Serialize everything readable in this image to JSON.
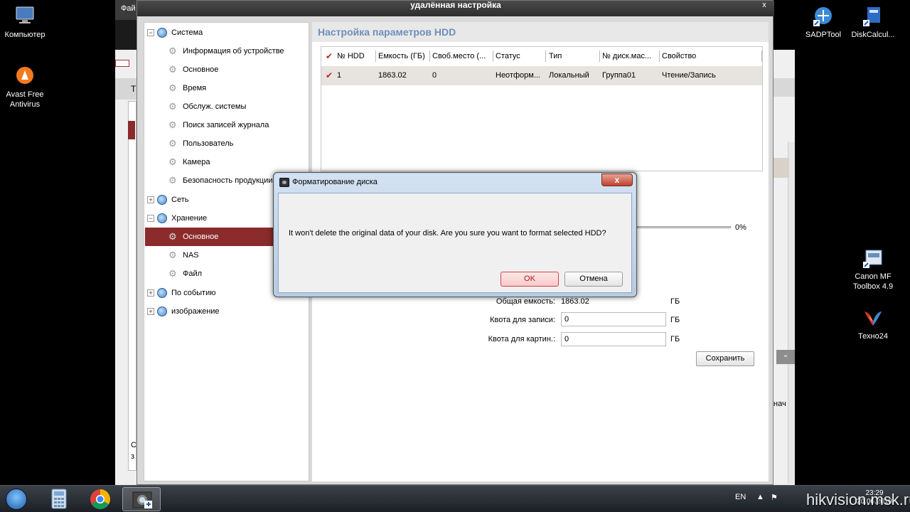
{
  "desktop": {
    "icons": [
      {
        "label": "Компьютер"
      },
      {
        "label": "Avast Free Antivirus"
      },
      {
        "label": "SADPTool"
      },
      {
        "label": "DiskCalcul..."
      },
      {
        "label": "Canon MF Toolbox 4.9"
      },
      {
        "label": "Техно24"
      }
    ]
  },
  "bg_app": {
    "title_fragment": "Фай",
    "tab_fragment": "Т",
    "low_text": "С з",
    "right_text": "нач"
  },
  "window": {
    "title": "удалённая настройка",
    "close_glyph": "x"
  },
  "sidebar": {
    "items": [
      {
        "label": "Система",
        "type": "group",
        "expanded": true
      },
      {
        "label": "Информация об устройстве",
        "type": "child"
      },
      {
        "label": "Основное",
        "type": "child"
      },
      {
        "label": "Время",
        "type": "child"
      },
      {
        "label": "Обслуж. системы",
        "type": "child"
      },
      {
        "label": "Поиск записей журнала",
        "type": "child"
      },
      {
        "label": "Пользователь",
        "type": "child"
      },
      {
        "label": "Камера",
        "type": "child"
      },
      {
        "label": "Безопасность продукции",
        "type": "child"
      },
      {
        "label": "Сеть",
        "type": "group",
        "expanded": false
      },
      {
        "label": "Хранение",
        "type": "group",
        "expanded": true
      },
      {
        "label": "Основное",
        "type": "child",
        "selected": true
      },
      {
        "label": "NAS",
        "type": "child"
      },
      {
        "label": "Файл",
        "type": "child"
      },
      {
        "label": "По событию",
        "type": "group",
        "expanded": false
      },
      {
        "label": "изображение",
        "type": "group",
        "expanded": false
      }
    ]
  },
  "content": {
    "title": "Настройка параметров HDD",
    "table": {
      "headers": [
        "№ HDD",
        "Емкость (ГБ)",
        "Своб.место (...",
        "Статус",
        "Тип",
        "№ диск.мас...",
        "Свойство"
      ],
      "rows": [
        [
          "1",
          "1863.02",
          "0",
          "Неотформ...",
          "Локальный",
          "Группа01",
          "Чтение/Запись"
        ]
      ]
    },
    "progress_pct": "0%",
    "form": {
      "total_label": "Общая емкость:",
      "total_value": "1863.02",
      "record_quota_label": "Квота для записи:",
      "record_quota_value": "0",
      "picture_quota_label": "Квота для картин.:",
      "picture_quota_value": "0",
      "unit": "ГБ"
    },
    "save_label": "Сохранить"
  },
  "dialog": {
    "title": "Форматирование диска",
    "message": "It won't delete the original data of your disk. Are you sure you want to format selected HDD?",
    "ok_label": "OK",
    "cancel_label": "Отмена",
    "close_glyph": "x"
  },
  "taskbar": {
    "lang": "EN",
    "time": "23:29",
    "date": "20.06.2018"
  },
  "watermark": "hikvision.msk.ru",
  "colors": {
    "accent": "#8b2b2b",
    "title_blue": "#6d8fbb",
    "check_red": "#c02020"
  }
}
